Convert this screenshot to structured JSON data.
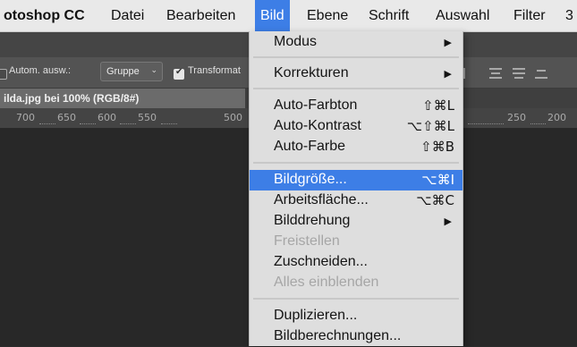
{
  "menubar": {
    "app": "otoshop CC",
    "items": [
      "Datei",
      "Bearbeiten",
      "Bild",
      "Ebene",
      "Schrift",
      "Auswahl",
      "Filter",
      "3"
    ],
    "active": "Bild"
  },
  "options": {
    "auto_select_label": "Autom. ausw.:",
    "auto_select_checked": false,
    "group_value": "Gruppe",
    "transform_label": "Transformat",
    "transform_checked": true
  },
  "document_tab": "ilda.jpg bei 100% (RGB/8#)",
  "ruler": {
    "left": [
      "700",
      "650",
      "600",
      "550",
      "500"
    ],
    "right": [
      "250",
      "200"
    ]
  },
  "bild_menu": {
    "items": [
      {
        "label": "Modus",
        "submenu": true
      },
      {
        "label": "Korrekturen",
        "submenu": true
      },
      {
        "label": "Auto-Farbton",
        "shortcut": "⇧⌘L"
      },
      {
        "label": "Auto-Kontrast",
        "shortcut": "⌥⇧⌘L"
      },
      {
        "label": "Auto-Farbe",
        "shortcut": "⇧⌘B"
      },
      {
        "label": "Bildgröße...",
        "shortcut": "⌥⌘I",
        "highlighted": true
      },
      {
        "label": "Arbeitsfläche...",
        "shortcut": "⌥⌘C"
      },
      {
        "label": "Bilddrehung",
        "submenu": true
      },
      {
        "label": "Freistellen",
        "disabled": true
      },
      {
        "label": "Zuschneiden..."
      },
      {
        "label": "Alles einblenden",
        "disabled": true
      },
      {
        "label": "Duplizieren..."
      },
      {
        "label": "Bildberechnungen..."
      }
    ]
  },
  "colors": {
    "accent": "#3d7ee6",
    "menu_bg": "#dedede",
    "workspace": "#282828"
  },
  "icons": {
    "submenu": "submenu-arrow-icon",
    "dropdown": "chevron-down-icon",
    "checkbox": "checkbox-icon",
    "align": "align-icon"
  }
}
